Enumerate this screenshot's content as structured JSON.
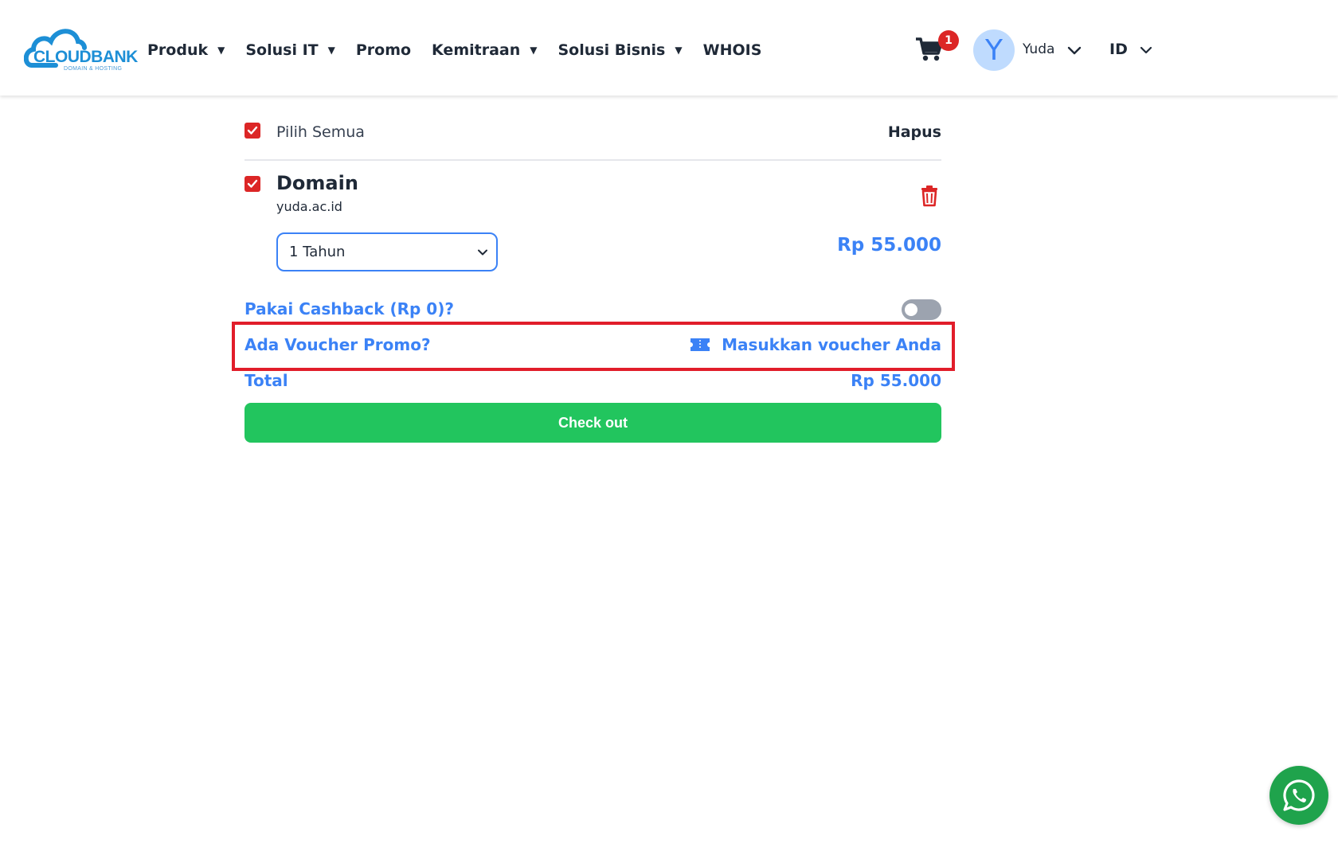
{
  "brand": {
    "name": "CLOUDBANK",
    "tagline": "DOMAIN & HOSTING",
    "primary_color": "#1d8fd6"
  },
  "nav": {
    "items": [
      {
        "label": "Produk",
        "dropdown": true
      },
      {
        "label": "Solusi IT",
        "dropdown": true
      },
      {
        "label": "Promo",
        "dropdown": false
      },
      {
        "label": "Kemitraan",
        "dropdown": true
      },
      {
        "label": "Solusi Bisnis",
        "dropdown": true
      },
      {
        "label": "WHOIS",
        "dropdown": false
      }
    ],
    "caret": "▼"
  },
  "header": {
    "cart_count": "1",
    "avatar_initial": "Y",
    "user_name": "Yuda",
    "language": "ID"
  },
  "cart": {
    "select_all_label": "Pilih Semua",
    "delete_all_label": "Hapus",
    "item": {
      "title": "Domain",
      "domain": "yuda.ac.id",
      "period": "1 Tahun",
      "price": "Rp 55.000"
    },
    "cashback_label": "Pakai Cashback (Rp 0)?",
    "cashback_enabled": false,
    "voucher_question": "Ada Voucher Promo?",
    "voucher_link": "Masukkan voucher Anda",
    "total_label": "Total",
    "total_value": "Rp 55.000",
    "checkout_label": "Check out"
  },
  "colors": {
    "accent": "#3b82f6",
    "danger": "#dc2626",
    "success": "#22c55e",
    "highlight": "#e11d2a",
    "whatsapp": "#1fa34c"
  }
}
